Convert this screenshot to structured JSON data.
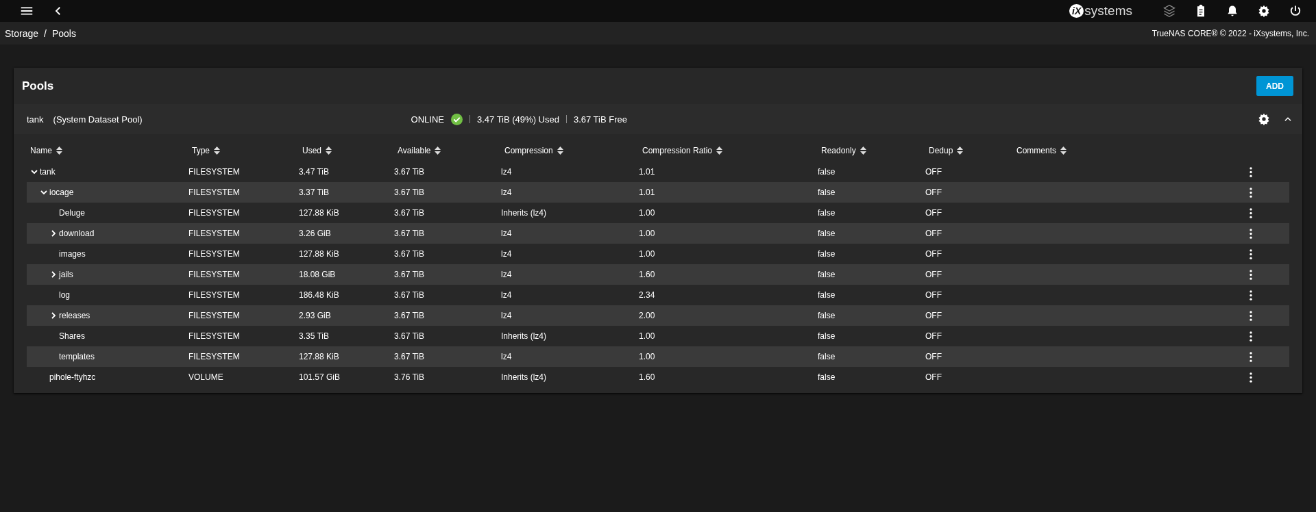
{
  "topbar": {
    "logo_mark": "iX",
    "logo_text": "systems"
  },
  "breadcrumb": {
    "items": [
      "Storage",
      "Pools"
    ],
    "separator": "/",
    "copyright": "TrueNAS CORE® © 2022 - iXsystems, Inc."
  },
  "page": {
    "title": "Pools",
    "add_button": "ADD"
  },
  "pool": {
    "name": "tank",
    "subtitle": "(System Dataset Pool)",
    "status": "ONLINE",
    "healthy": true,
    "used": "3.47 TiB (49%) Used",
    "free": "3.67 TiB Free",
    "expanded": true
  },
  "table": {
    "columns": [
      "Name",
      "Type",
      "Used",
      "Available",
      "Compression",
      "Compression Ratio",
      "Readonly",
      "Dedup",
      "Comments"
    ],
    "rows": [
      {
        "name": "tank",
        "type": "FILESYSTEM",
        "used": "3.47 TiB",
        "available": "3.67 TiB",
        "compression": "lz4",
        "ratio": "1.01",
        "readonly": "false",
        "dedup": "OFF",
        "expanded": true,
        "children": [
          {
            "name": "iocage",
            "type": "FILESYSTEM",
            "used": "3.37 TiB",
            "available": "3.67 TiB",
            "compression": "lz4",
            "ratio": "1.01",
            "readonly": "false",
            "dedup": "OFF",
            "expanded": true,
            "children": [
              {
                "name": "Deluge",
                "type": "FILESYSTEM",
                "used": "127.88 KiB",
                "available": "3.67 TiB",
                "compression": "Inherits (lz4)",
                "ratio": "1.00",
                "readonly": "false",
                "dedup": "OFF"
              },
              {
                "name": "download",
                "type": "FILESYSTEM",
                "used": "3.26 GiB",
                "available": "3.67 TiB",
                "compression": "lz4",
                "ratio": "1.00",
                "readonly": "false",
                "dedup": "OFF",
                "expanded": false
              },
              {
                "name": "images",
                "type": "FILESYSTEM",
                "used": "127.88 KiB",
                "available": "3.67 TiB",
                "compression": "lz4",
                "ratio": "1.00",
                "readonly": "false",
                "dedup": "OFF"
              },
              {
                "name": "jails",
                "type": "FILESYSTEM",
                "used": "18.08 GiB",
                "available": "3.67 TiB",
                "compression": "lz4",
                "ratio": "1.60",
                "readonly": "false",
                "dedup": "OFF",
                "expanded": false
              },
              {
                "name": "log",
                "type": "FILESYSTEM",
                "used": "186.48 KiB",
                "available": "3.67 TiB",
                "compression": "lz4",
                "ratio": "2.34",
                "readonly": "false",
                "dedup": "OFF"
              },
              {
                "name": "releases",
                "type": "FILESYSTEM",
                "used": "2.93 GiB",
                "available": "3.67 TiB",
                "compression": "lz4",
                "ratio": "2.00",
                "readonly": "false",
                "dedup": "OFF",
                "expanded": false
              },
              {
                "name": "Shares",
                "type": "FILESYSTEM",
                "used": "3.35 TiB",
                "available": "3.67 TiB",
                "compression": "Inherits (lz4)",
                "ratio": "1.00",
                "readonly": "false",
                "dedup": "OFF"
              },
              {
                "name": "templates",
                "type": "FILESYSTEM",
                "used": "127.88 KiB",
                "available": "3.67 TiB",
                "compression": "lz4",
                "ratio": "1.00",
                "readonly": "false",
                "dedup": "OFF"
              }
            ]
          },
          {
            "name": "pihole-ftyhzc",
            "type": "VOLUME",
            "used": "101.57 GiB",
            "available": "3.76 TiB",
            "compression": "Inherits (lz4)",
            "ratio": "1.60",
            "readonly": "false",
            "dedup": "OFF"
          }
        ]
      }
    ]
  }
}
